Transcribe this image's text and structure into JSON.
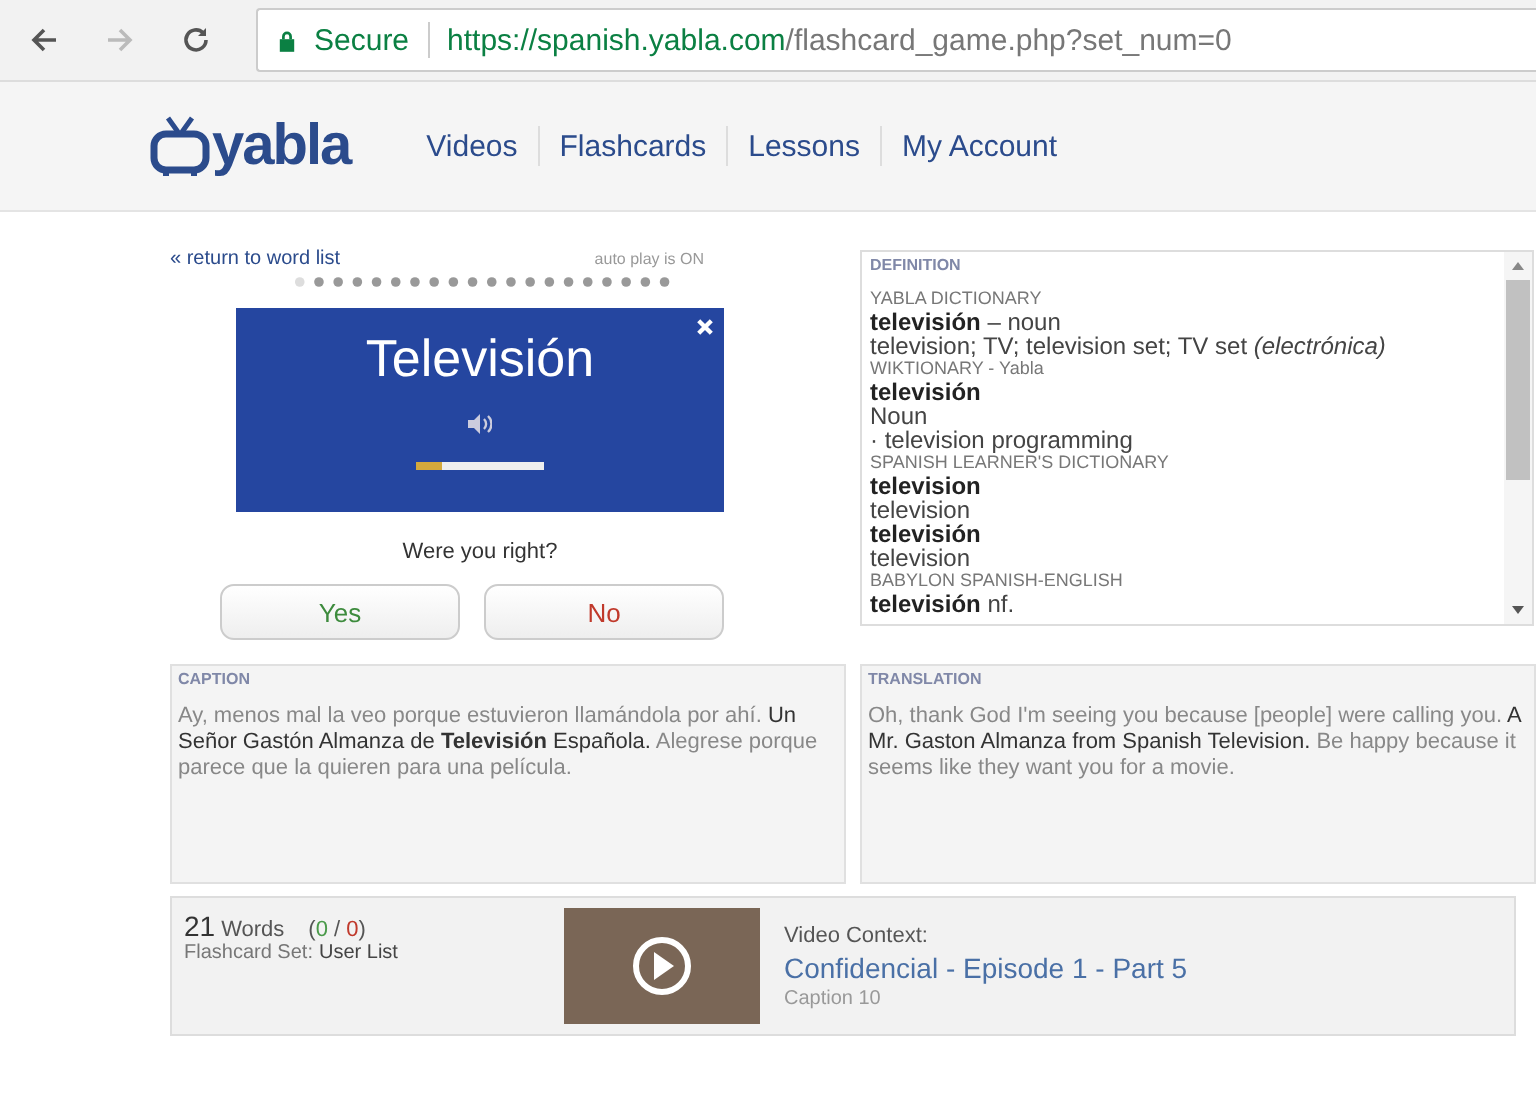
{
  "browser": {
    "secure_label": "Secure",
    "url_host": "https://spanish.yabla.com",
    "url_path": "/flashcard_game.php?set_num=0"
  },
  "site_header": {
    "logo": "yabla",
    "nav": [
      {
        "label": "Videos"
      },
      {
        "label": "Flashcards"
      },
      {
        "label": "Lessons"
      },
      {
        "label": "My Account"
      }
    ]
  },
  "flashcard": {
    "return_link": "« return to word list",
    "autoplay": "auto play is ON",
    "word": "Televisión",
    "level": 0.2,
    "question": "Were you right?",
    "buttons": [
      {
        "label": "Yes",
        "kind": "yes"
      },
      {
        "label": "No",
        "kind": "no"
      }
    ]
  },
  "definition": {
    "heading": "DEFINITION",
    "lines": [
      {
        "kind": "source",
        "text": "YABLA DICTIONARY"
      },
      {
        "kind": "entry",
        "text": "**televisión** – noun"
      },
      {
        "kind": "entry",
        "text": "television; TV; television set; TV set *(electrónica)*"
      },
      {
        "kind": "source",
        "text": "WIKTIONARY - Yabla"
      },
      {
        "kind": "entry",
        "text": "**televisión**"
      },
      {
        "kind": "entry",
        "text": "Noun"
      },
      {
        "kind": "entry",
        "text": "· television programming"
      },
      {
        "kind": "source",
        "text": "SPANISH LEARNER'S DICTIONARY"
      },
      {
        "kind": "entry",
        "text": "**television**"
      },
      {
        "kind": "entry",
        "text": "television"
      },
      {
        "kind": "entry",
        "text": "**televisión**"
      },
      {
        "kind": "entry",
        "text": "television"
      },
      {
        "kind": "source",
        "text": "BABYLON SPANISH-ENGLISH"
      },
      {
        "kind": "entry",
        "text": "**televisión** nf."
      }
    ]
  },
  "caption": {
    "heading": "CAPTION",
    "segments": [
      {
        "text": "Ay, menos mal la veo porque estuvieron llamándola por ahí.",
        "highlighted": false
      },
      {
        "text": "Un Señor Gastón Almanza de **Televisión** Española.",
        "highlighted": true
      },
      {
        "text": "Alegrese porque parece que la quieren para una película.",
        "highlighted": false
      }
    ]
  },
  "translation": {
    "heading": "TRANSLATION",
    "segments": [
      {
        "text": "Oh, thank God I'm seeing you because [people] were calling you.",
        "highlighted": false
      },
      {
        "text": "A Mr. Gaston Almanza from Spanish Television.",
        "highlighted": true
      },
      {
        "text": "Be happy because it seems like they want you for a movie.",
        "highlighted": false
      }
    ]
  },
  "footer": {
    "word_count": "21",
    "words_label": "Words",
    "score": [
      {
        "text": "(",
        "kind": "plain"
      },
      {
        "text": "0",
        "kind": "correct"
      },
      {
        "text": " / ",
        "kind": "plain"
      },
      {
        "text": "0",
        "kind": "wrong"
      },
      {
        "text": ")",
        "kind": "plain"
      }
    ],
    "set_label": "Flashcard Set:",
    "set_name": "User List",
    "video_context_label": "Video Context:",
    "video_title": "Confidencial - Episode 1 - Part 5",
    "caption_number": "Caption 10"
  }
}
